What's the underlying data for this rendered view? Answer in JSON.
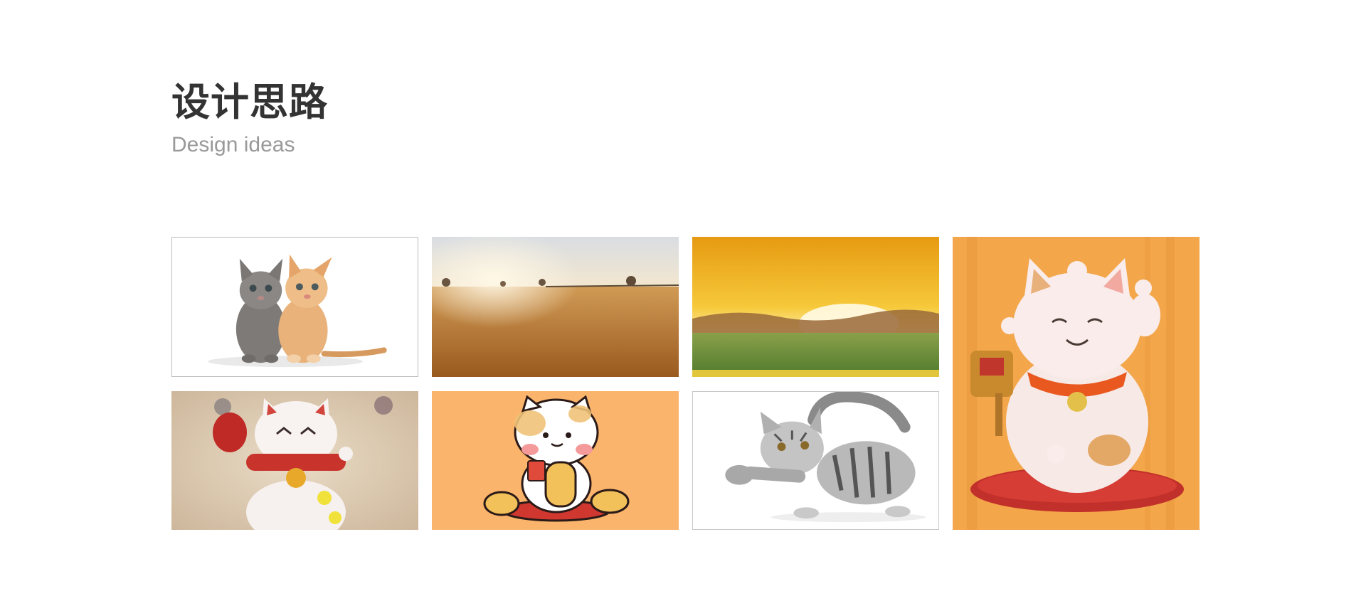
{
  "header": {
    "title": "设计思路",
    "subtitle": "Design ideas"
  },
  "gallery": [
    {
      "icon": "two-kittens-photo"
    },
    {
      "icon": "golden-field-sunset-photo"
    },
    {
      "icon": "painted-sunrise-landscape"
    },
    {
      "icon": "lucky-cat-illustration"
    },
    {
      "icon": "lucky-cat-figurine-photo"
    },
    {
      "icon": "lucky-cat-cartoon"
    },
    {
      "icon": "tabby-kitten-photo"
    }
  ],
  "colors": {
    "title": "#333333",
    "subtitle": "#999999",
    "accent_orange": "#f3a64a",
    "cartoon_bg": "#fbb46b"
  }
}
